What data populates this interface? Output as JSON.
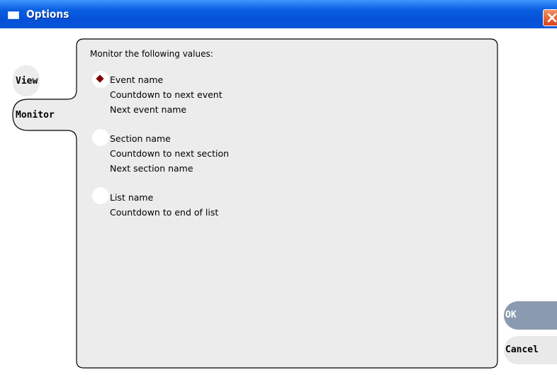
{
  "window": {
    "title": "Options",
    "icon": "window-icon",
    "close_icon": "close-icon"
  },
  "tabs": [
    {
      "label": "View",
      "selected": false
    },
    {
      "label": "Monitor",
      "selected": true
    }
  ],
  "panel": {
    "heading": "Monitor the following values:",
    "options": [
      {
        "selected": true,
        "lines": [
          "Event name",
          "Countdown to next event",
          "Next event name"
        ]
      },
      {
        "selected": false,
        "lines": [
          "Section name",
          "Countdown to next section",
          "Next section name"
        ]
      },
      {
        "selected": false,
        "lines": [
          "List name",
          "Countdown to end of list"
        ]
      }
    ]
  },
  "buttons": {
    "ok_label": "OK",
    "cancel_label": "Cancel"
  },
  "colors": {
    "titlebar": "#0a5fe0",
    "panel": "#ececec",
    "radio_selected": "#800000",
    "ok_button": "#8a9ab0"
  }
}
